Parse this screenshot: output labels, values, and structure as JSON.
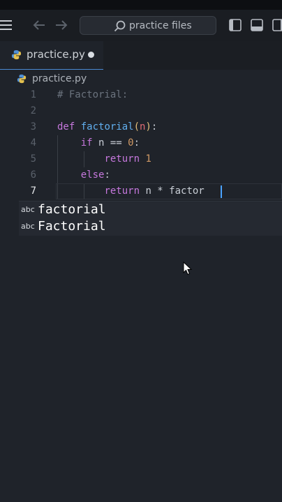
{
  "header": {
    "search_text": "practice files"
  },
  "tab": {
    "label": "practice.py"
  },
  "breadcrumb": {
    "file": "practice.py"
  },
  "editor": {
    "lines": [
      {
        "num": "1",
        "text": "# Factorial:"
      },
      {
        "num": "2",
        "text": ""
      },
      {
        "num": "3",
        "text": "def factorial(n):"
      },
      {
        "num": "4",
        "text": "    if n == 0:"
      },
      {
        "num": "5",
        "text": "        return 1"
      },
      {
        "num": "6",
        "text": "    else:"
      },
      {
        "num": "7",
        "text": "        return n * factor"
      }
    ],
    "active_line": "7"
  },
  "suggestions": [
    {
      "kind": "abc",
      "label": "factorial"
    },
    {
      "kind": "abc",
      "label": "Factorial"
    }
  ],
  "colors": {
    "accent": "#4a8ad4",
    "keyword": "#c678dd",
    "function": "#61afef",
    "number": "#d19a66"
  }
}
